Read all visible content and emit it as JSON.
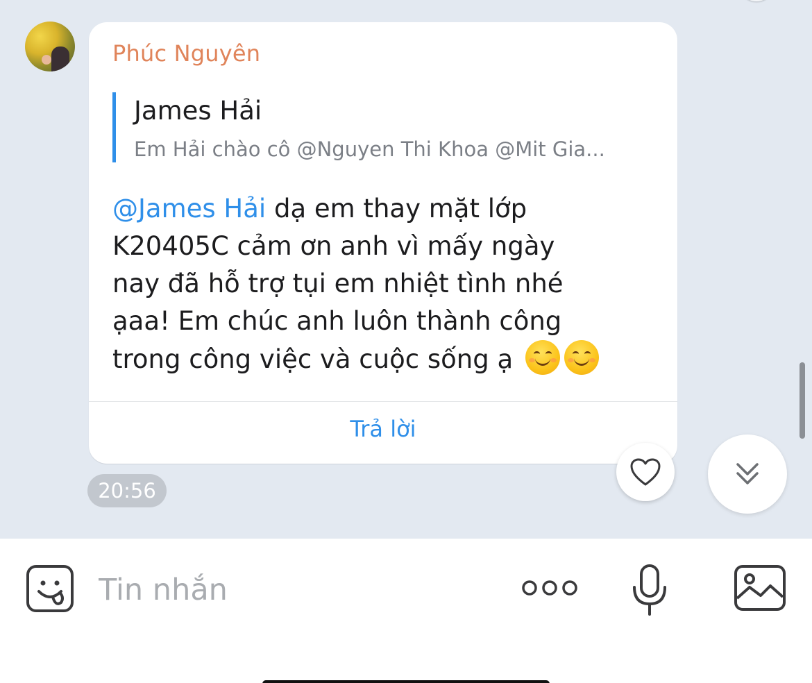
{
  "message": {
    "sender_name": "Phúc Nguyên",
    "quote": {
      "name": "James Hải",
      "text": "Em Hải chào cô @Nguyen Thi Khoa @Mit Gia..."
    },
    "mention": "@James Hải",
    "body_line1": " dạ em thay mặt lớp",
    "body_line2": "K20405C cảm ơn anh vì mấy ngày",
    "body_line3": "nay đã hỗ trợ tụi em nhiệt tình nhé",
    "body_line4": "ạaa! Em chúc anh luôn thành công",
    "body_line5": "trong công việc và cuộc sống ạ",
    "emojis": [
      "smiling-face-icon",
      "smiling-face-icon"
    ],
    "reply_label": "Trả lời",
    "time": "20:56"
  },
  "input": {
    "placeholder": "Tin nhắn"
  },
  "icons": {
    "heart": "heart-icon",
    "scroll_down": "chevron-double-down-icon",
    "sticker": "sticker-face-icon",
    "more": "more-options-icon",
    "mic": "microphone-icon",
    "image": "image-icon"
  },
  "colors": {
    "sender": "#e0845a",
    "accent": "#2f8fe9",
    "chat_background": "#e3e9f1"
  }
}
